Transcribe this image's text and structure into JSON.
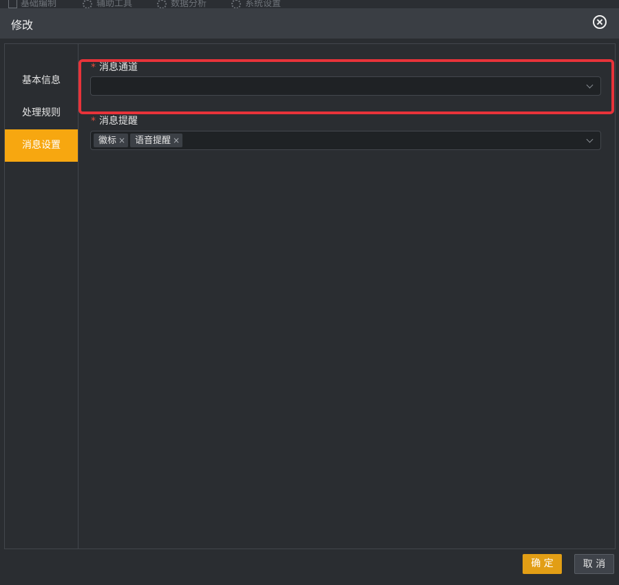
{
  "background_nav": {
    "items": [
      "基础编制",
      "辅助工具",
      "数据分析",
      "系统设置"
    ]
  },
  "dialog": {
    "title": "修改",
    "close_icon": "close-circle-icon"
  },
  "sidebar": {
    "items": [
      {
        "label": "基本信息",
        "active": false
      },
      {
        "label": "处理规则",
        "active": false
      },
      {
        "label": "消息设置",
        "active": true
      }
    ]
  },
  "form": {
    "channel": {
      "label": "消息通道",
      "required_mark": "*",
      "value": ""
    },
    "reminder": {
      "label": "消息提醒",
      "required_mark": "*",
      "tags": [
        "徽标",
        "语音提醒"
      ],
      "tag_close_glyph": "×"
    }
  },
  "footer": {
    "confirm_label": "确 定",
    "cancel_label": "取 消"
  },
  "colors": {
    "accent": "#f7a710",
    "confirm_button": "#e29e15",
    "highlight_border": "#e8333a",
    "required": "#e74c3c"
  }
}
